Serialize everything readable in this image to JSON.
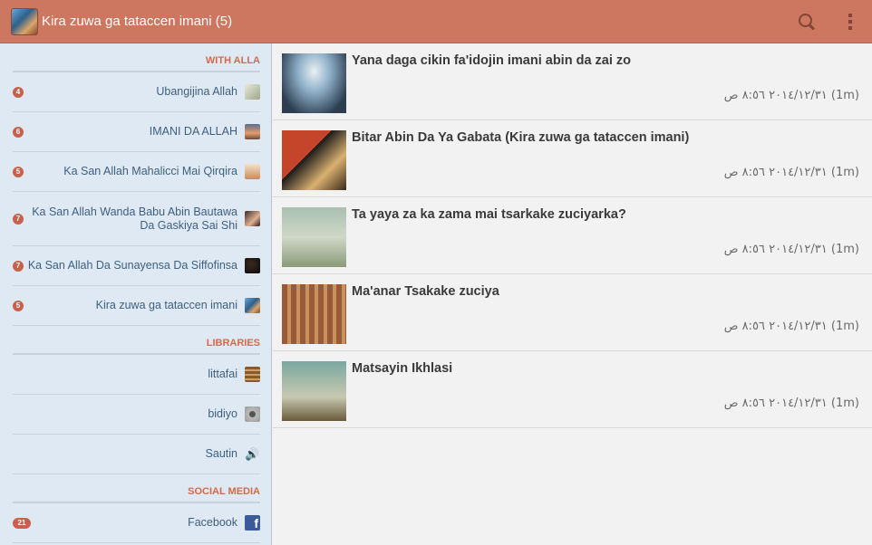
{
  "app": {
    "title": "Kira zuwa ga tataccen imani (5)"
  },
  "drawer": {
    "sections": [
      {
        "heading": "WITH ALLA",
        "items": [
          {
            "count": "4",
            "label": "Ubangijina Allah"
          },
          {
            "count": "6",
            "label": "IMANI DA ALLAH"
          },
          {
            "count": "5",
            "label": "Ka San Allah Mahalicci Mai Qirqira"
          },
          {
            "count": "7",
            "label": "Ka San Allah Wanda Babu Abin Bautawa Da Gaskiya Sai Shi"
          },
          {
            "count": "7",
            "label": "Ka San Allah Da Sunayensa Da Siffofinsa"
          },
          {
            "count": "5",
            "label": "Kira zuwa ga tataccen imani"
          }
        ]
      },
      {
        "heading": "LIBRARIES",
        "items": [
          {
            "label": "littafai"
          },
          {
            "label": "bidiyo"
          },
          {
            "label": "Sautin"
          }
        ]
      },
      {
        "heading": "SOCIAL MEDIA",
        "items": [
          {
            "count": "21",
            "label": "Facebook"
          }
        ]
      }
    ]
  },
  "articles": [
    {
      "title": "Yana daga cikin fa'idojin imani abin da zai zo",
      "meta": "٢٠١٤/١٢/٣١ ٨:٥٦ ص (1m)"
    },
    {
      "title": "Bitar Abin Da Ya Gabata (Kira zuwa ga tataccen imani)",
      "meta": "٢٠١٤/١٢/٣١ ٨:٥٦ ص (1m)"
    },
    {
      "title": "Ta yaya za ka zama mai tsarkake zuciyarka?",
      "meta": "٢٠١٤/١٢/٣١ ٨:٥٦ ص (1m)"
    },
    {
      "title": "Ma'anar Tsakake zuciya",
      "meta": "٢٠١٤/١٢/٣١ ٨:٥٦ ص (1m)"
    },
    {
      "title": "Matsayin Ikhlasi",
      "meta": "٢٠١٤/١٢/٣١ ٨:٥٦ ص (1m)"
    }
  ],
  "icons": {
    "search": "search-icon",
    "overflow": "overflow-menu-icon",
    "facebook": "facebook-icon",
    "speaker": "speaker-icon"
  },
  "colors": {
    "actionbar": "#cd7660",
    "accent": "#d46a4a",
    "drawer_bg": "#dfe9f3",
    "badge": "#c8614c"
  }
}
